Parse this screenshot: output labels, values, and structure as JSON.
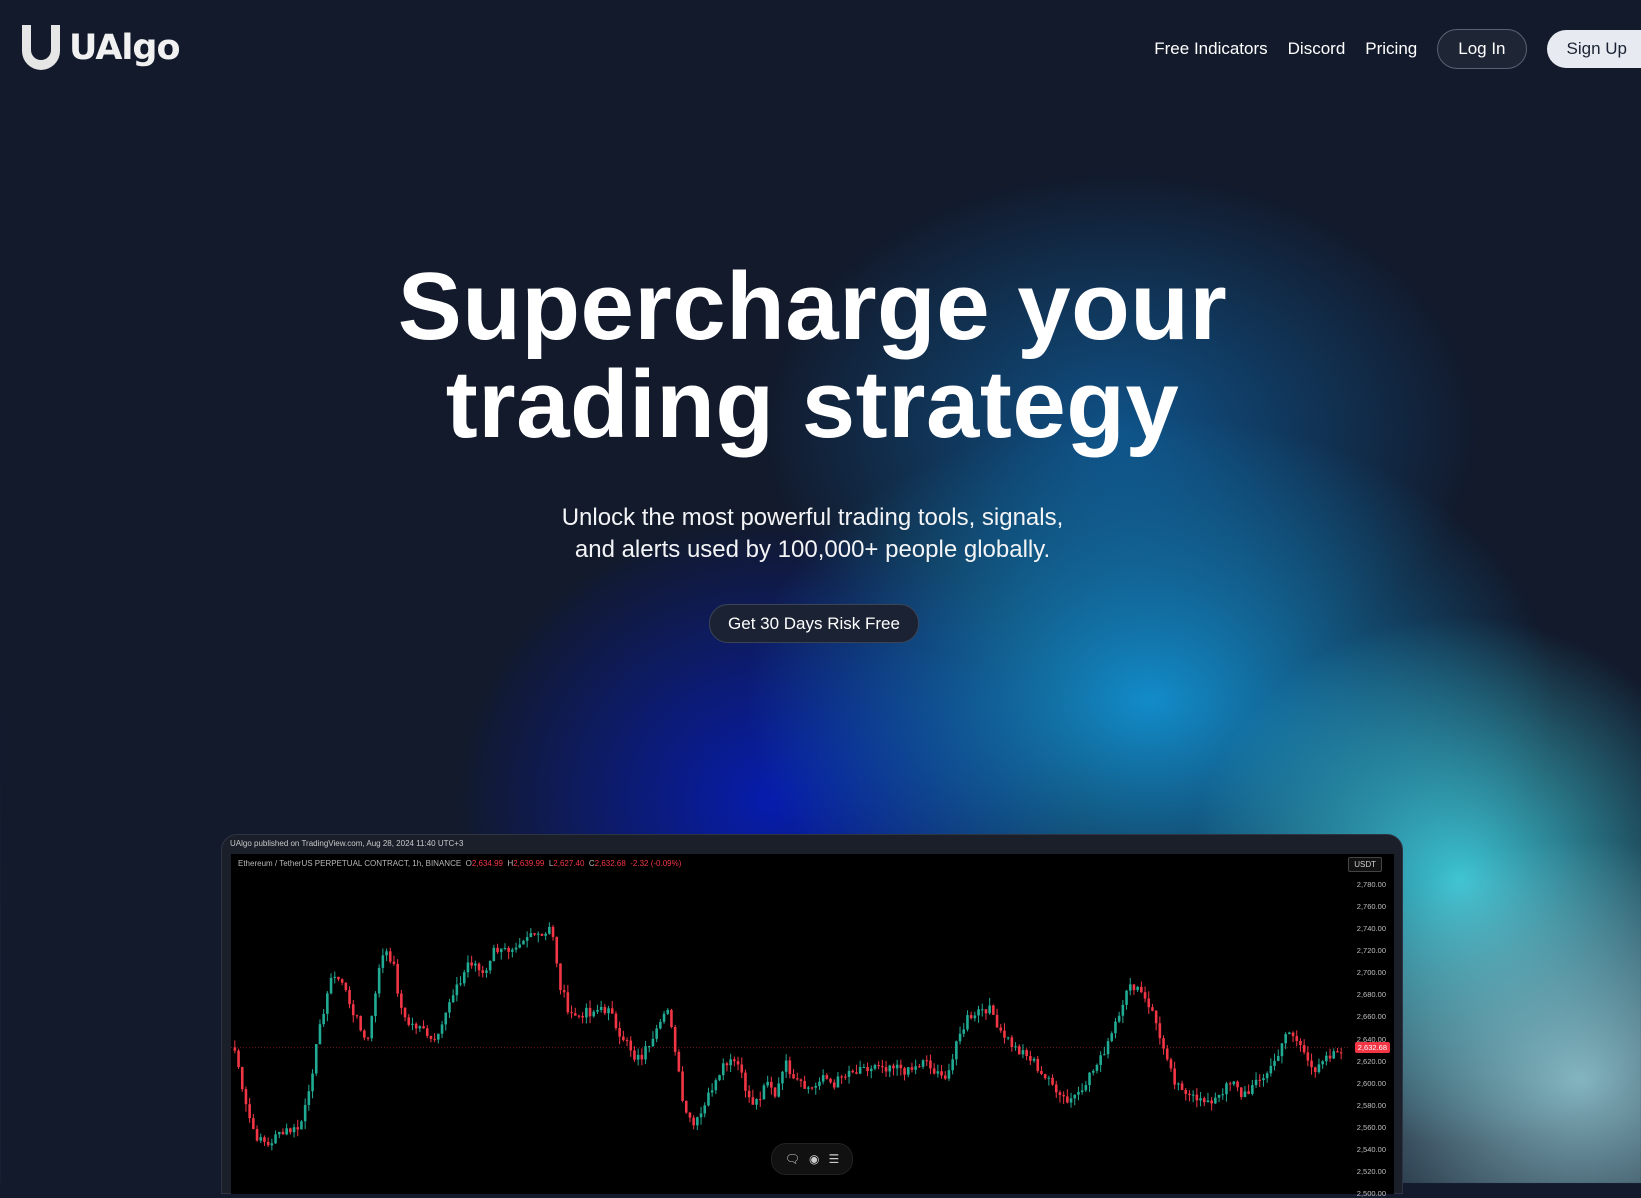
{
  "nav": {
    "brand": "UAlgo",
    "links": [
      "Free Indicators",
      "Discord",
      "Pricing"
    ],
    "login_label": "Log In",
    "signup_label": "Sign Up"
  },
  "hero": {
    "title_line1": "Supercharge your",
    "title_line2": "trading strategy",
    "subtitle_line1": "Unlock the most powerful trading tools, signals,",
    "subtitle_line2": "and alerts used by 100,000+ people globally.",
    "cta_label": "Get 30 Days Risk Free"
  },
  "chart": {
    "published": "UAlgo published on TradingView.com, Aug 28, 2024 11:40 UTC+3",
    "symbol": "Ethereum / TetherUS PERPETUAL CONTRACT, 1h, BINANCE",
    "ohlc": {
      "o": "2,634.99",
      "h": "2,639.99",
      "l": "2,627.40",
      "c": "2,632.68",
      "change": "-2.32 (-0.09%)"
    },
    "currency": "USDT",
    "last_price": "2,632.68",
    "price_ticks": [
      "2,780.00",
      "2,760.00",
      "2,740.00",
      "2,720.00",
      "2,700.00",
      "2,680.00",
      "2,660.00",
      "2,640.00",
      "2,620.00",
      "2,600.00",
      "2,580.00",
      "2,560.00",
      "2,540.00",
      "2,520.00",
      "2,500.00"
    ],
    "colors": {
      "up": "#22ab94",
      "down": "#f23645"
    },
    "toolbar_icons": [
      "comment-icon",
      "eye-icon",
      "list-icon"
    ]
  },
  "chart_data": {
    "type": "candlestick",
    "ylim": [
      2500,
      2790
    ],
    "closes": [
      2630,
      2595,
      2562,
      2548,
      2545,
      2552,
      2560,
      2558,
      2565,
      2600,
      2640,
      2680,
      2700,
      2690,
      2670,
      2650,
      2640,
      2690,
      2725,
      2710,
      2665,
      2655,
      2650,
      2648,
      2640,
      2660,
      2675,
      2690,
      2710,
      2705,
      2700,
      2720,
      2725,
      2715,
      2720,
      2730,
      2740,
      2735,
      2745,
      2690,
      2670,
      2660,
      2665,
      2660,
      2670,
      2665,
      2650,
      2640,
      2620,
      2625,
      2640,
      2660,
      2665,
      2630,
      2580,
      2565,
      2575,
      2590,
      2610,
      2620,
      2625,
      2610,
      2580,
      2585,
      2600,
      2590,
      2620,
      2610,
      2605,
      2595,
      2600,
      2605,
      2600,
      2605,
      2608,
      2610,
      2612,
      2615,
      2610,
      2612,
      2615,
      2610,
      2615,
      2620,
      2610,
      2605,
      2615,
      2640,
      2660,
      2665,
      2670,
      2665,
      2650,
      2640,
      2630,
      2625,
      2620,
      2610,
      2600,
      2595,
      2585,
      2590,
      2600,
      2610,
      2620,
      2640,
      2660,
      2680,
      2690,
      2685,
      2670,
      2650,
      2620,
      2600,
      2590,
      2595,
      2585,
      2580,
      2590,
      2595,
      2600,
      2590,
      2595,
      2600,
      2610,
      2620,
      2640,
      2645,
      2635,
      2625,
      2610,
      2620,
      2625,
      2632
    ]
  }
}
